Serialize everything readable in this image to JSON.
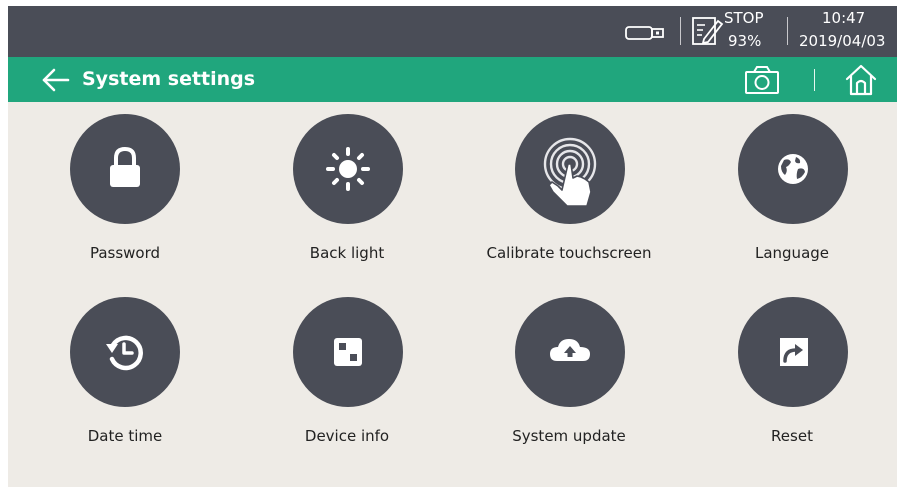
{
  "status_bar": {
    "status_label": "STOP",
    "battery_percent": "93%",
    "time": "10:47",
    "date": "2019/04/03"
  },
  "header": {
    "title": "System settings"
  },
  "tiles": [
    {
      "label": "Password",
      "icon": "lock-icon"
    },
    {
      "label": "Back light",
      "icon": "brightness-icon"
    },
    {
      "label": "Calibrate touchscreen",
      "icon": "touch-icon"
    },
    {
      "label": "Language",
      "icon": "globe-icon"
    },
    {
      "label": "Date time",
      "icon": "clock-history-icon"
    },
    {
      "label": "Device info",
      "icon": "device-info-icon"
    },
    {
      "label": "System update",
      "icon": "cloud-upload-icon"
    },
    {
      "label": "Reset",
      "icon": "reset-arrow-icon"
    }
  ],
  "colors": {
    "status_bar_bg": "#4a4d57",
    "header_bg": "#20a67d",
    "content_bg": "#eeebe6",
    "icon_circle": "#4a4d57",
    "label_text": "#222222"
  }
}
